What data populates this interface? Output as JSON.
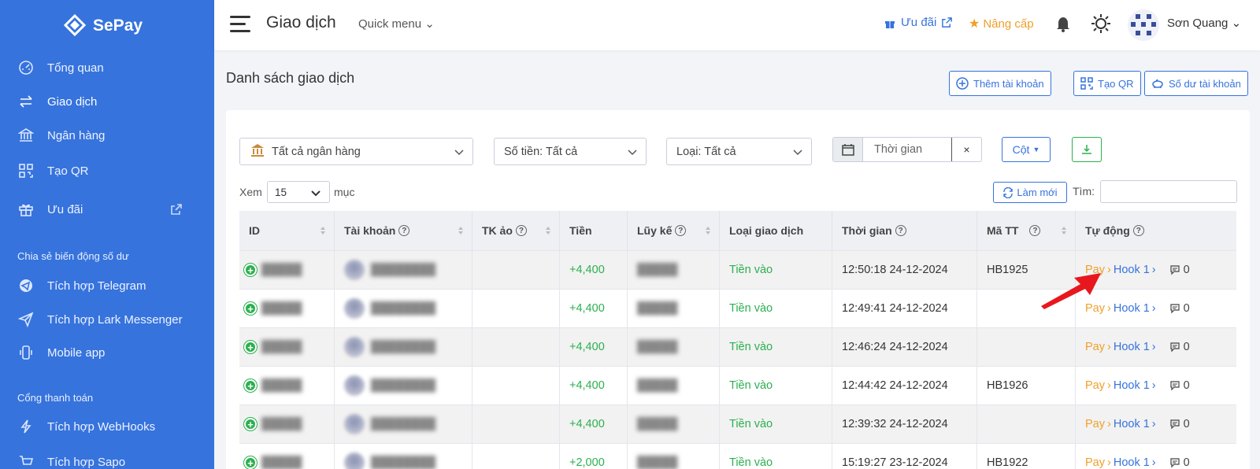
{
  "brand": {
    "name": "SePay"
  },
  "sidebar": {
    "items": [
      {
        "label": "Tổng quan",
        "icon": "dashboard-icon"
      },
      {
        "label": "Giao dịch",
        "icon": "transfer-icon",
        "active": true
      },
      {
        "label": "Ngân hàng",
        "icon": "bank-icon"
      },
      {
        "label": "Tạo QR",
        "icon": "qr-icon"
      },
      {
        "label": "Ưu đãi",
        "icon": "gift-icon"
      }
    ],
    "section1": "Chia sẻ biến động số dư",
    "share_items": [
      {
        "label": "Tích hợp Telegram",
        "icon": "telegram-icon"
      },
      {
        "label": "Tích hợp Lark Messenger",
        "icon": "send-icon"
      },
      {
        "label": "Mobile app",
        "icon": "mobile-icon"
      }
    ],
    "section2": "Cổng thanh toán",
    "payment_items": [
      {
        "label": "Tích hợp WebHooks",
        "icon": "bolt-icon"
      },
      {
        "label": "Tích hợp Sapo",
        "icon": "cart-icon"
      }
    ]
  },
  "header": {
    "title": "Giao dịch",
    "quick_menu": "Quick menu",
    "promo": "Ưu đãi",
    "upgrade": "Nâng cấp",
    "username": "Sơn Quang"
  },
  "content": {
    "title": "Danh sách giao dịch",
    "buttons": {
      "add_account": "Thêm tài khoản",
      "create_qr": "Tạo QR",
      "balance": "Số dư tài khoản"
    },
    "filters": {
      "bank": "Tất cả ngân hàng",
      "amount": "Số tiền: Tất cả",
      "type": "Loại: Tất cả",
      "date_placeholder": "Thời gian",
      "columns": "Cột"
    },
    "show_label": "Xem",
    "page_size": "15",
    "entries_label": "mục",
    "refresh": "Làm mới",
    "search_label": "Tìm:"
  },
  "table": {
    "headers": [
      "ID",
      "Tài khoản",
      "TK ảo",
      "Tiền",
      "Lũy kế",
      "Loại giao dịch",
      "Thời gian",
      "Mã TT",
      "Tự động"
    ],
    "rows": [
      {
        "amount": "+4,400",
        "type": "Tiền vào",
        "time": "12:50:18 24-12-2024",
        "code": "HB1925",
        "pay": "Pay",
        "hook": "Hook 1",
        "comments": "0"
      },
      {
        "amount": "+4,400",
        "type": "Tiền vào",
        "time": "12:49:41 24-12-2024",
        "code": "",
        "pay": "Pay",
        "hook": "Hook 1",
        "comments": "0"
      },
      {
        "amount": "+4,400",
        "type": "Tiền vào",
        "time": "12:46:24 24-12-2024",
        "code": "",
        "pay": "Pay",
        "hook": "Hook 1",
        "comments": "0"
      },
      {
        "amount": "+4,400",
        "type": "Tiền vào",
        "time": "12:44:42 24-12-2024",
        "code": "HB1926",
        "pay": "Pay",
        "hook": "Hook 1",
        "comments": "0"
      },
      {
        "amount": "+4,400",
        "type": "Tiền vào",
        "time": "12:39:32 24-12-2024",
        "code": "",
        "pay": "Pay",
        "hook": "Hook 1",
        "comments": "0"
      },
      {
        "amount": "+2,000",
        "type": "Tiền vào",
        "time": "15:19:27 23-12-2024",
        "code": "HB1922",
        "pay": "Pay",
        "hook": "Hook 1",
        "comments": "0"
      }
    ]
  },
  "colors": {
    "primary": "#3673dd",
    "success": "#2bb04f",
    "warning": "#f0a02a",
    "annotation": "#e8171d"
  }
}
